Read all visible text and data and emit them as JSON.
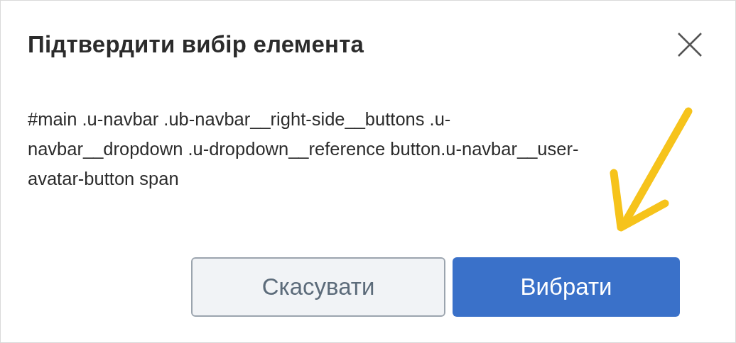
{
  "dialog": {
    "title": "Підтвердити вибір елемента",
    "message": "#main .u-navbar .ub-navbar__right-side__buttons .u-navbar__dropdown .u-dropdown__reference button.u-navbar__user-avatar-button span",
    "buttons": [
      {
        "label": "Скасувати",
        "kind": "secondary"
      },
      {
        "label": "Вибрати",
        "kind": "primary"
      }
    ]
  }
}
